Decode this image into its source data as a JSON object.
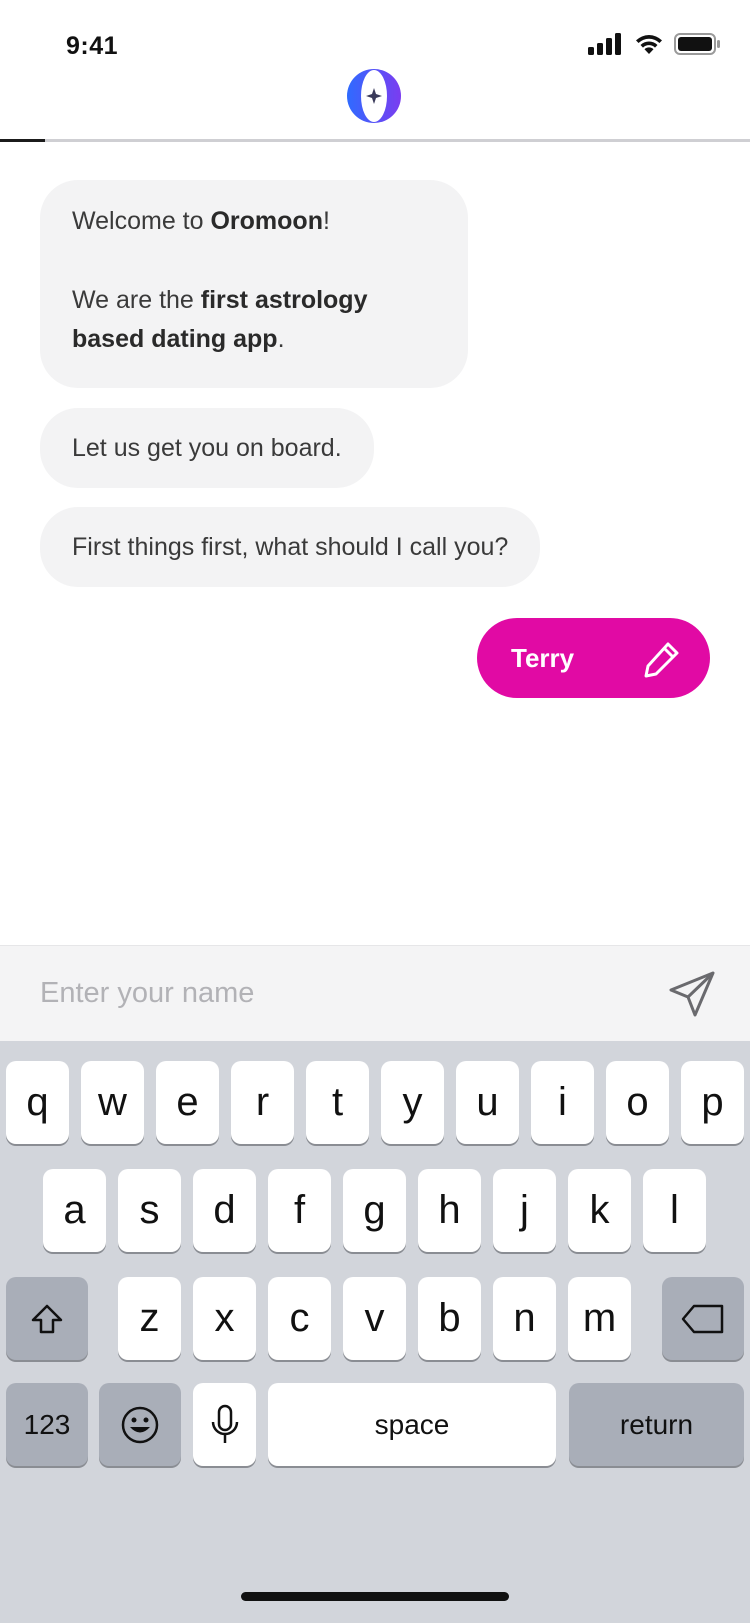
{
  "status_bar": {
    "time": "9:41",
    "icons": [
      "cellular-signal-icon",
      "wifi-icon",
      "battery-icon"
    ]
  },
  "header": {
    "logo": "oromoon-logo",
    "progress": 0.06
  },
  "chat": {
    "bubble1": {
      "line1_pre": "Welcome to ",
      "line1_bold": "Oromoon",
      "line1_post": "!",
      "line2_pre": "We are the ",
      "line2_bold": "first astrology based dating app",
      "line2_post": "."
    },
    "bubble2": "Let us get you on board.",
    "bubble3": "First things first, what should I call you?",
    "reply": {
      "text": "Terry",
      "icon": "pencil-icon"
    }
  },
  "input": {
    "placeholder": "Enter your name",
    "value": "",
    "send_icon": "send-icon"
  },
  "keyboard": {
    "row1": [
      "q",
      "w",
      "e",
      "r",
      "t",
      "y",
      "u",
      "i",
      "o",
      "p"
    ],
    "row2": [
      "a",
      "s",
      "d",
      "f",
      "g",
      "h",
      "j",
      "k",
      "l"
    ],
    "row3": [
      "z",
      "x",
      "c",
      "v",
      "b",
      "n",
      "m"
    ],
    "numbers_label": "123",
    "space_label": "space",
    "return_label": "return"
  },
  "colors": {
    "accent": "#e10aa4",
    "bubble": "#f3f3f4",
    "keyboard_bg": "#d2d5db",
    "logo_blue": "#2f6bff",
    "logo_purple": "#7b3cf0"
  }
}
